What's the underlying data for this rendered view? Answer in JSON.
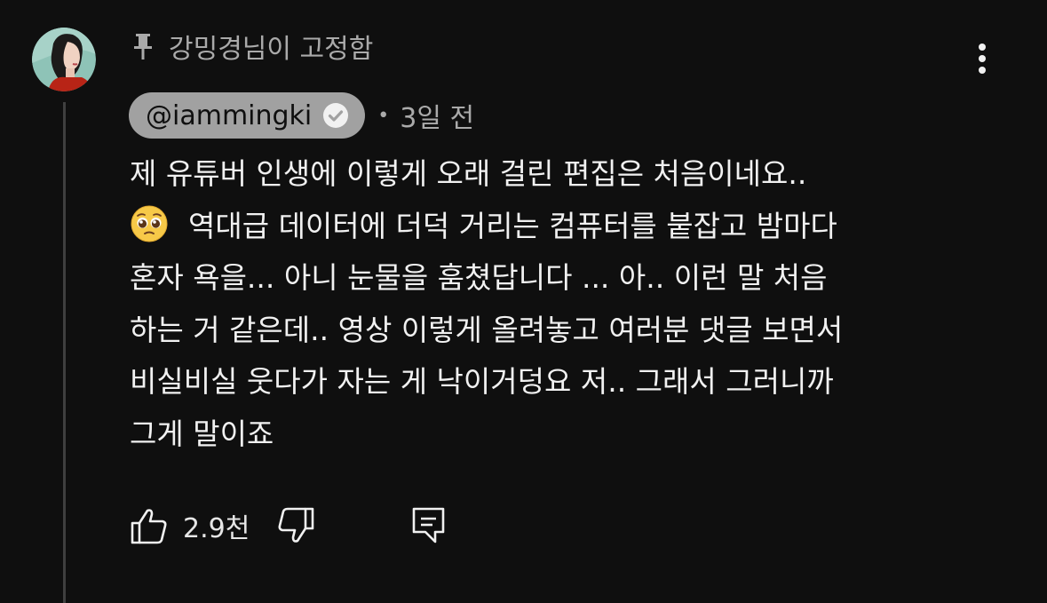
{
  "comment": {
    "pinned_label": "강밍경님이 고정함",
    "author": "@iammingki",
    "timestamp": "3일 전",
    "separator": "•",
    "lines": [
      "제 유튜버 인생에 이렇게 오래 걸린 편집은 처음이네요..",
      "역대급 데이터에 더덕 거리는 컴퓨터를 붙잡고 밤마다",
      "혼자 욕을... 아니 눈물을 훔쳤답니다 ... 아.. 이런 말 처음",
      "하는 거 같은데.. 영상 이렇게 올려놓고 여러분 댓글 보면서",
      "비실비실 웃다가 자는 게 낙이거덩요 저.. 그래서 그러니까",
      "그게 말이죠"
    ],
    "emoji": "pleading-face-emoji",
    "like_count": "2.9천"
  },
  "icons": {
    "pin": "pin-icon",
    "more": "more-vertical-icon",
    "verified": "verified-checkmark-icon",
    "like": "thumbs-up-icon",
    "dislike": "thumbs-down-icon",
    "reply": "reply-comment-icon"
  },
  "colors": {
    "background": "#0f0f0f",
    "text_primary": "#f1f1f1",
    "text_secondary": "#aaaaaa",
    "author_chip": "#a1a1a1",
    "thread_line": "#3f3f3f"
  }
}
